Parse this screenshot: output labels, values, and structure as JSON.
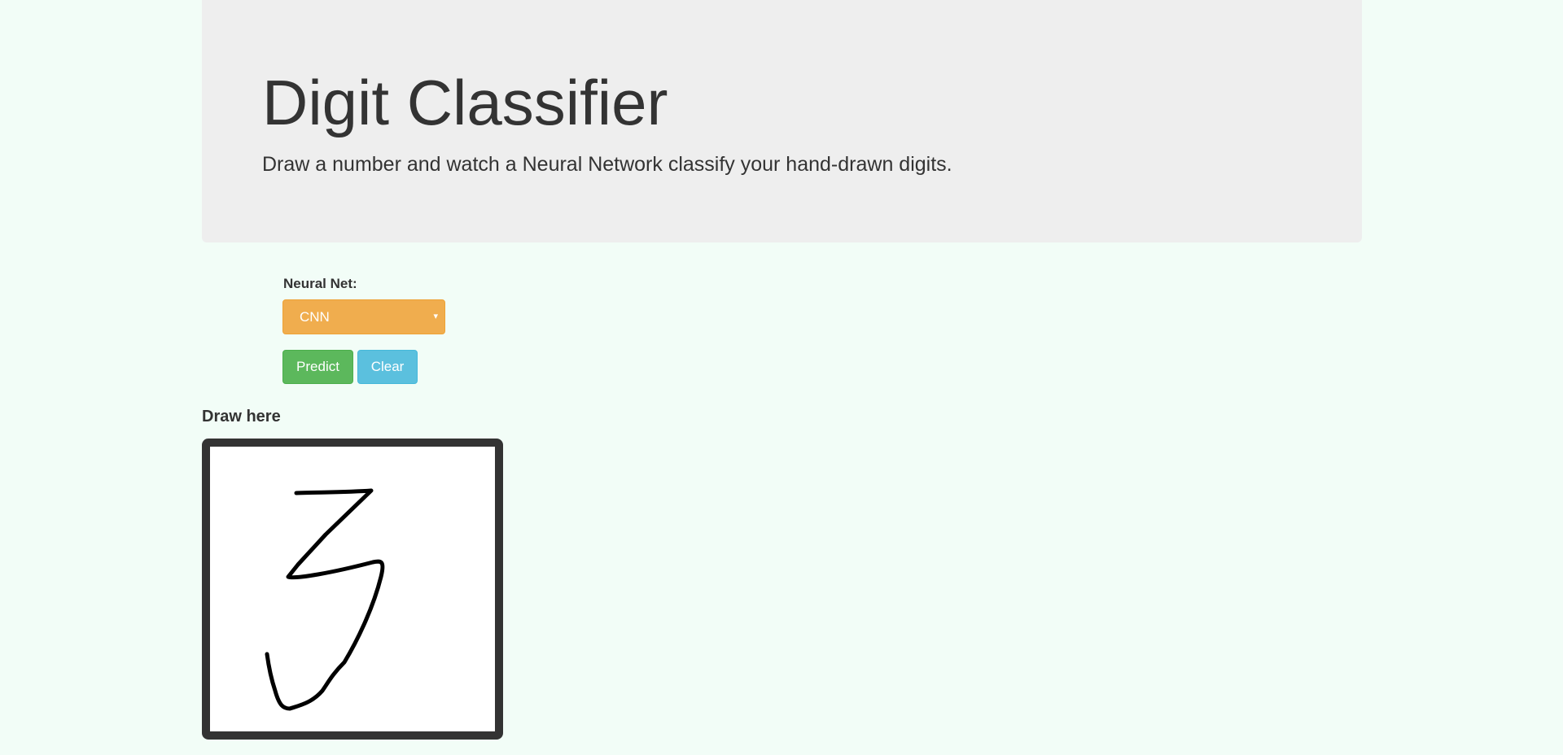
{
  "header": {
    "title": "Digit Classifier",
    "subtitle": "Draw a number and watch a Neural Network classify your hand-drawn digits."
  },
  "controls": {
    "net_label": "Neural Net:",
    "net_selected": "CNN",
    "select_caret": "▾",
    "predict_label": "Predict",
    "clear_label": "Clear"
  },
  "canvas": {
    "label": "Draw here",
    "stroke_color": "#000000",
    "border_color": "#333333"
  },
  "colors": {
    "jumbotron_bg": "#eeeeee",
    "page_bg": "#f2fdf7",
    "select_bg": "#f0ad4e",
    "predict_bg": "#5cb85c",
    "clear_bg": "#5bc0de"
  }
}
